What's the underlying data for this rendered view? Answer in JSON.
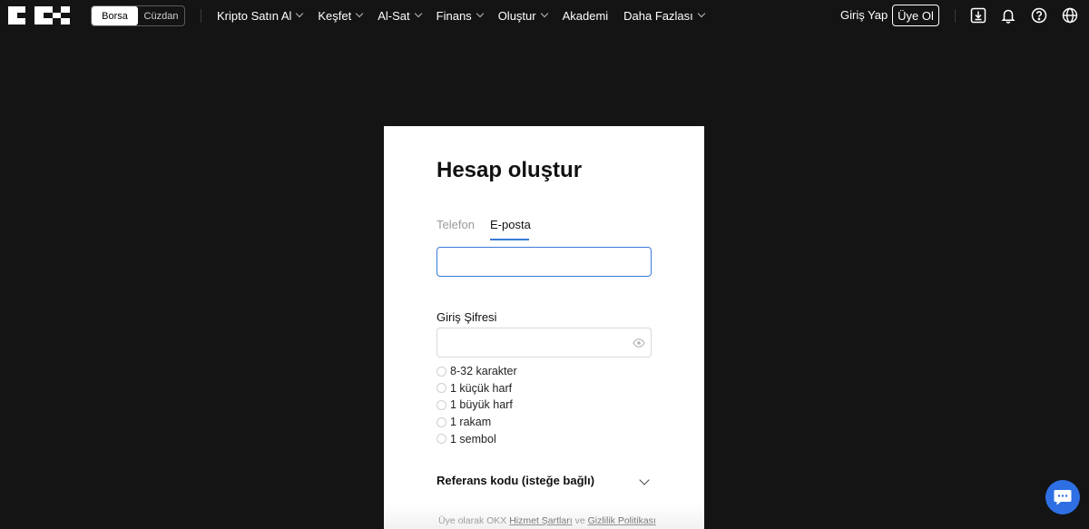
{
  "header": {
    "segment": {
      "active": "Borsa",
      "inactive": "Cüzdan"
    },
    "nav": [
      {
        "label": "Kripto Satın Al",
        "has_menu": true
      },
      {
        "label": "Keşfet",
        "has_menu": true
      },
      {
        "label": "Al-Sat",
        "has_menu": true
      },
      {
        "label": "Finans",
        "has_menu": true
      },
      {
        "label": "Oluştur",
        "has_menu": true
      },
      {
        "label": "Akademi",
        "has_menu": false
      },
      {
        "label": "Daha Fazlası",
        "has_menu": true
      }
    ],
    "login_label": "Giriş Yap",
    "signup_label": "Üye Ol",
    "icons": [
      "download-icon",
      "bell-icon",
      "help-icon",
      "globe-icon"
    ]
  },
  "card": {
    "title": "Hesap oluştur",
    "tabs": {
      "phone": "Telefon",
      "email": "E-posta",
      "active": "email"
    },
    "email_value": "",
    "password_label": "Giriş Şifresi",
    "password_value": "",
    "rules": [
      "8-32 karakter",
      "1 küçük harf",
      "1 büyük harf",
      "1 rakam",
      "1 sembol"
    ],
    "referral_label": "Referans kodu (isteğe bağlı)",
    "terms": {
      "prefix": "Üye olarak OKX",
      "tos": "Hizmet Şartları",
      "and": "ve",
      "privacy": "Gizlilik Politikası"
    }
  },
  "colors": {
    "background": "#141414",
    "accent": "#3a7bd5",
    "chat_button": "#2f6fe4"
  }
}
